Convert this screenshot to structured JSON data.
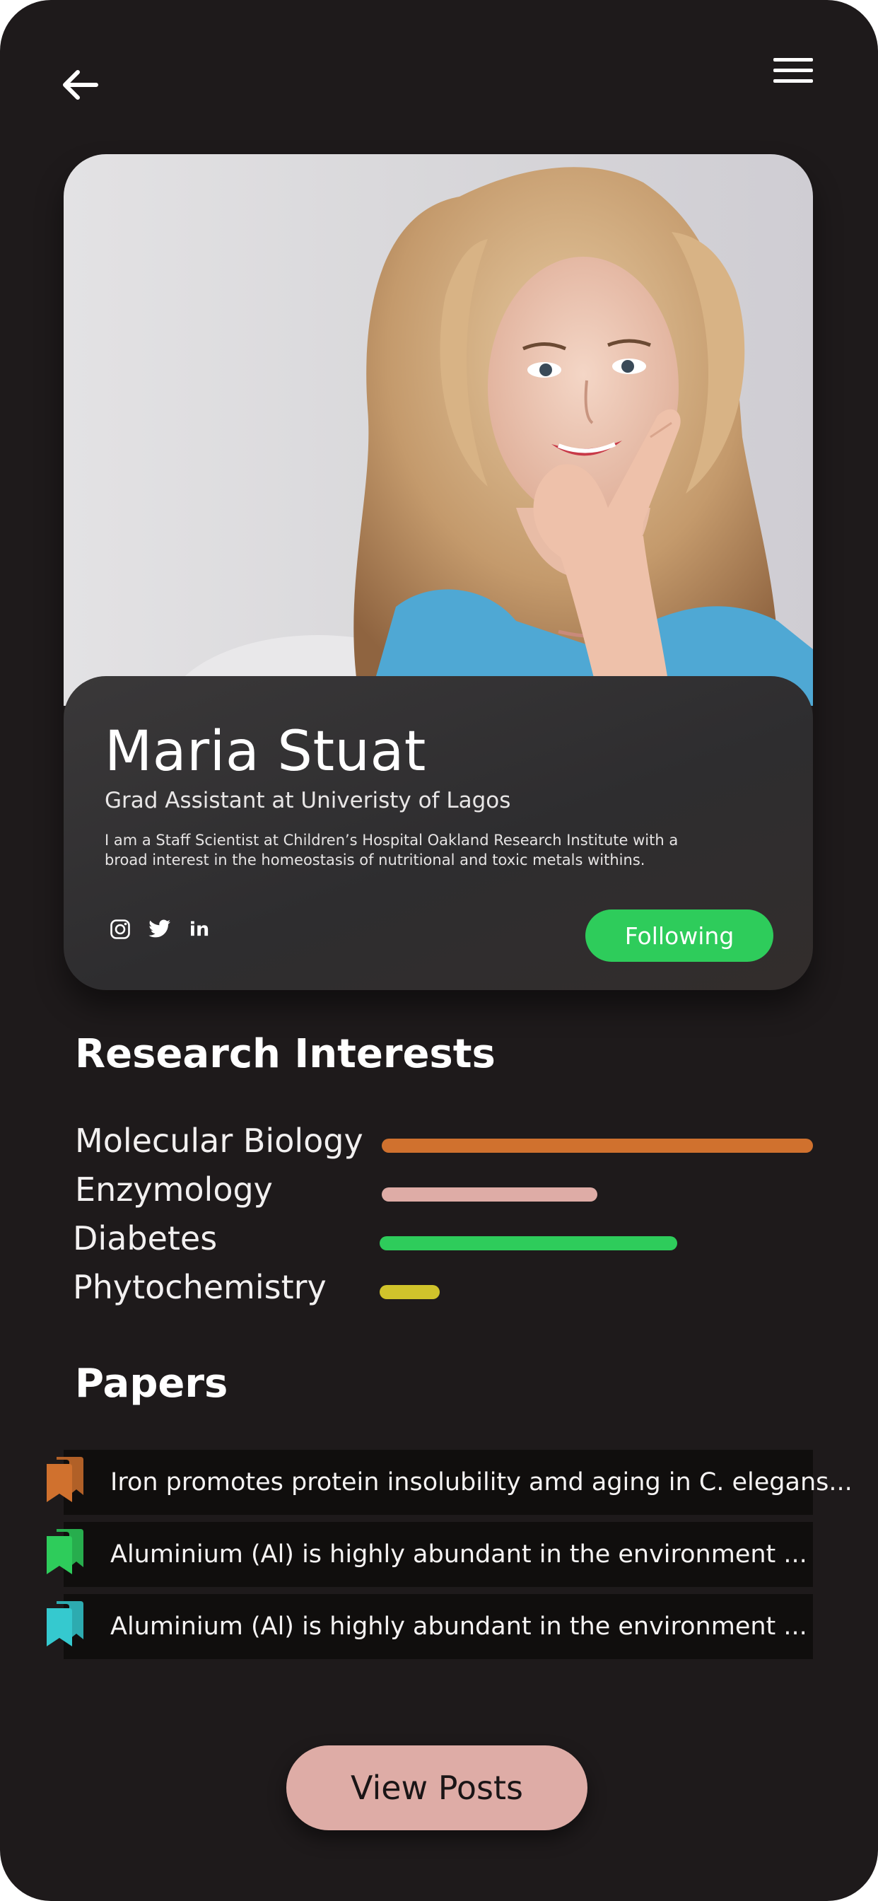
{
  "header": {
    "back_icon": "arrow-left-icon",
    "menu_icon": "hamburger-menu-icon"
  },
  "profile": {
    "name": "Maria Stuat",
    "role": "Grad Assistant at Univeristy of Lagos",
    "bio": "I am a Staff Scientist at Children’s Hospital Oakland Research Institute with a broad interest in the homeostasis of nutritional and toxic metals withins.",
    "socials": [
      {
        "icon": "instagram-icon"
      },
      {
        "icon": "twitter-icon"
      },
      {
        "icon": "linkedin-icon",
        "glyph": "in"
      }
    ],
    "follow_label": "Following",
    "follow_color": "#2ecc5b"
  },
  "interests": {
    "title": "Research Interests",
    "items": [
      {
        "label": "Molecular Biology",
        "level": 1.0,
        "color": "#d0712e"
      },
      {
        "label": "Enzymology",
        "level": 0.5,
        "color": "#deaca6"
      },
      {
        "label": "Diabetes",
        "level": 0.69,
        "color": "#2ecc5b"
      },
      {
        "label": "Phytochemistry",
        "level": 0.14,
        "color": "#d0c32b"
      }
    ]
  },
  "papers": {
    "title": "Papers",
    "items": [
      {
        "title": "Iron promotes protein insolubility amd aging in C. elegans...",
        "icon": "bookmark-icon",
        "color": "#d0712e"
      },
      {
        "title": "Aluminium (Al) is highly abundant in the environment ...",
        "icon": "bookmark-icon",
        "color": "#2ecc5b"
      },
      {
        "title": "Aluminium (Al) is highly abundant in the environment ...",
        "icon": "bookmark-icon",
        "color": "#35c9cf"
      }
    ]
  },
  "footer": {
    "view_posts_label": "View Posts",
    "view_posts_color": "#deaca6"
  }
}
